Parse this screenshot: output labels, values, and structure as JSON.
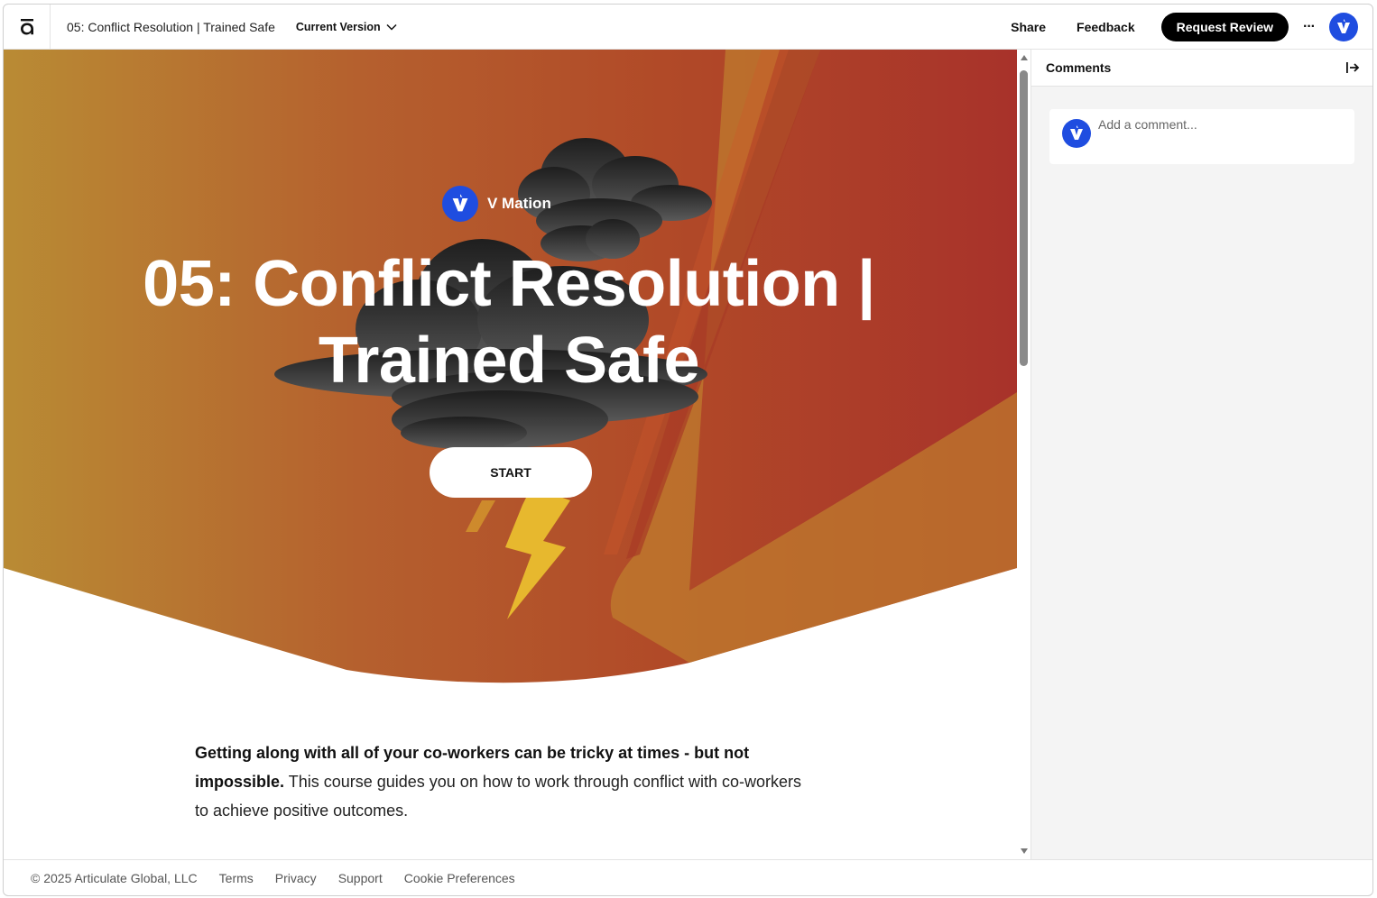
{
  "header": {
    "doc_title": "05: Conflict Resolution | Trained Safe",
    "version_label": "Current Version",
    "share_label": "Share",
    "feedback_label": "Feedback",
    "request_review_label": "Request Review",
    "more_label": "···",
    "logo_icon": "articulate-a-icon",
    "avatar_icon": "v-mation-avatar-icon"
  },
  "hero": {
    "brand_name": "V Mation",
    "title": "05: Conflict Resolution | Trained Safe",
    "start_label": "START",
    "colors": {
      "left": "#b98b34",
      "mid": "#b5572c",
      "right": "#a83a25",
      "accent": "#e7b82e"
    }
  },
  "intro": {
    "bold_text": "Getting along with all of your co-workers can be tricky at times - but not impossible.",
    "body_text": " This course guides you on how to work through conflict with co-workers to achieve positive outcomes."
  },
  "comments": {
    "title": "Comments",
    "placeholder": "Add a comment..."
  },
  "footer": {
    "copyright": "© 2025 Articulate Global, LLC",
    "links": [
      "Terms",
      "Privacy",
      "Support",
      "Cookie Preferences"
    ]
  },
  "brand_color": "#1f4de0"
}
